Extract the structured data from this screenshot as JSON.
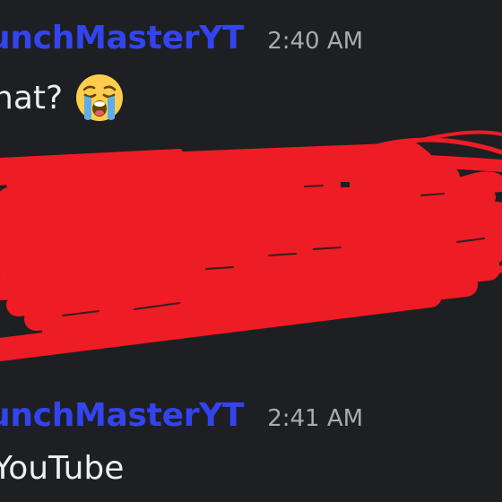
{
  "messages": [
    {
      "username": "unchMasterYT",
      "timestamp": "2:40 AM",
      "text": "hat?",
      "emoji": "loudly-crying-face-icon"
    },
    {
      "username": "unchMasterYT",
      "timestamp": "2:41 AM",
      "text": "YouTube"
    }
  ],
  "colors": {
    "background": "#1e1f22",
    "username": "#3344ee",
    "timestamp": "#a9abb2",
    "message_text": "#eceef1",
    "redaction": "#ee1c24"
  }
}
